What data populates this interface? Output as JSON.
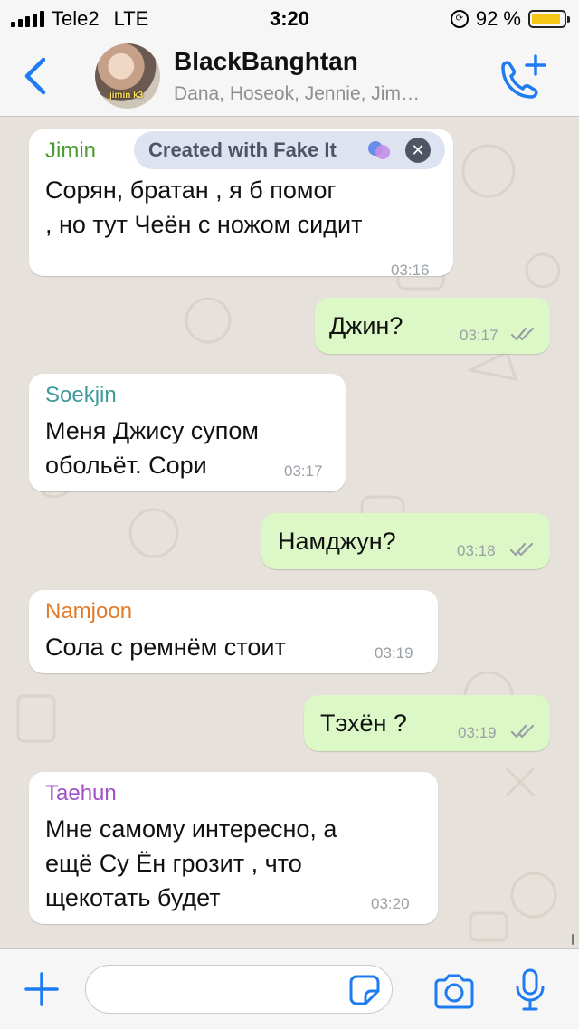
{
  "status_bar": {
    "carrier": "Tele2",
    "network": "LTE",
    "time": "3:20",
    "battery": "92 %",
    "battery_level": 0.92
  },
  "header": {
    "title": "BlackBanghtan",
    "subtitle": "Dana, Hoseok, Jennie, Jim…",
    "avatar_caption": "jimin k3",
    "back_icon": "chevron-left-icon",
    "call_icon": "add-call-icon"
  },
  "watermark": {
    "label": "Created with Fake It"
  },
  "messages": [
    {
      "sender": "Jimin",
      "sender_color": "#4b9a2f",
      "lines": [
        "Сорян, братан , я б помог",
        ", но тут Чеён с ножом сидит"
      ],
      "time": "03:16"
    },
    {
      "text": "Джин?",
      "time": "03:17"
    },
    {
      "sender": "Soekjin",
      "sender_color": "#3f9a9a",
      "lines": [
        "Меня Джису супом",
        "обольёт. Сори"
      ],
      "time": "03:17"
    },
    {
      "text": "Намджун?",
      "time": "03:18"
    },
    {
      "sender": "Namjoon",
      "sender_color": "#e07b2a",
      "lines": [
        "Сола с ремнём стоит"
      ],
      "time": "03:19"
    },
    {
      "text": "Тэхён ?",
      "time": "03:19"
    },
    {
      "sender": "Taehun",
      "sender_color": "#a34fc9",
      "lines": [
        "Мне самому интересно, а",
        "ещё Су Ён грозит , что",
        "щекотать будет"
      ],
      "time": "03:20"
    }
  ],
  "input_bar": {
    "placeholder": "",
    "value": ""
  },
  "colors": {
    "accent": "#1e7bf2",
    "incoming": "#ffffff",
    "outgoing": "#dcf8c6",
    "wallpaper": "#e6e1da",
    "ticks": "#9aa0a6"
  }
}
